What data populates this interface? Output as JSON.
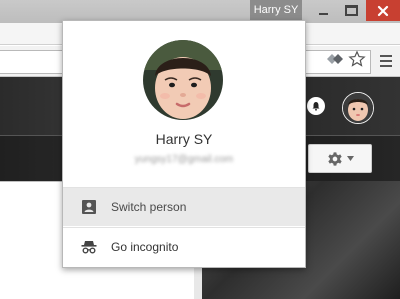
{
  "window": {
    "profile_name": "Harry SY"
  },
  "popup": {
    "name": "Harry SY",
    "email": "yungsy17@gmail.com",
    "items": [
      {
        "label": "Switch person",
        "icon": "person-card-icon"
      },
      {
        "label": "Go incognito",
        "icon": "incognito-icon"
      }
    ]
  },
  "colors": {
    "close_button": "#c84031",
    "profile_badge": "#8c8c8c",
    "selected_item": "#e9e9e9"
  }
}
